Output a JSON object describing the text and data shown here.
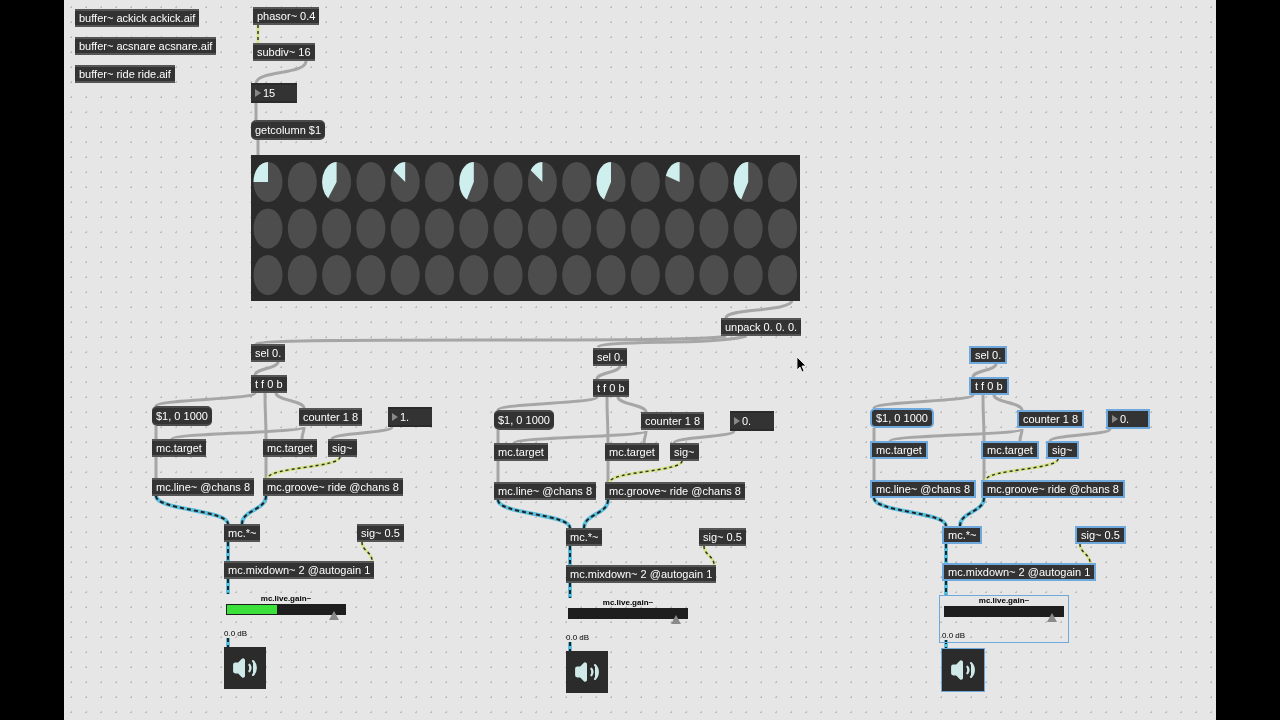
{
  "buffers": [
    "buffer~ ackick ackick.aif",
    "buffer~ acsnare acsnare.aif",
    "buffer~ ride ride.aif"
  ],
  "phasor": "phasor~ 0.4",
  "subdiv": "subdiv~ 16",
  "step_number": "15",
  "getcolumn": "getcolumn $1",
  "unpack": "unpack 0. 0. 0.",
  "voices": [
    {
      "selected": false,
      "sel": "sel 0.",
      "trigger": "t f 0 b",
      "message": "$1, 0 1000",
      "counter": "counter 1 8",
      "number": "1.",
      "target_1": "mc.target",
      "target_2": "mc.target",
      "sig": "sig~",
      "line": "mc.line~ @chans 8",
      "groove": "mc.groove~ ride @chans 8",
      "multiply": "mc.*~",
      "sig_const": "sig~ 0.5",
      "mixdown": "mc.mixdown~ 2 @autogain 1",
      "gain": {
        "label": "mc.live.gain~",
        "reading": "0.0 dB",
        "meter": {
          "level": 0.42
        },
        "level": 0.9
      }
    },
    {
      "selected": false,
      "sel": "sel 0.",
      "trigger": "t f 0 b",
      "message": "$1, 0 1000",
      "counter": "counter 1 8",
      "number": "0.",
      "target_1": "mc.target",
      "target_2": "mc.target",
      "sig": "sig~",
      "line": "mc.line~ @chans 8",
      "groove": "mc.groove~ ride @chans 8",
      "multiply": "mc.*~",
      "sig_const": "sig~ 0.5",
      "mixdown": "mc.mixdown~ 2 @autogain 1",
      "gain": {
        "label": "mc.live.gain~",
        "reading": "0.0 dB",
        "level": 0.9
      }
    },
    {
      "selected": true,
      "sel": "sel 0.",
      "trigger": "t f 0 b",
      "message": "$1, 0 1000",
      "counter": "counter 1 8",
      "number": "0.",
      "target_1": "mc.target",
      "target_2": "mc.target",
      "sig": "sig~",
      "line": "mc.line~ @chans 8",
      "groove": "mc.groove~ ride @chans 8",
      "multiply": "mc.*~",
      "sig_const": "sig~ 0.5",
      "mixdown": "mc.mixdown~ 2 @autogain 1",
      "gain": {
        "label": "mc.live.gain~",
        "reading": "0.0 dB",
        "level": 0.9
      }
    }
  ]
}
